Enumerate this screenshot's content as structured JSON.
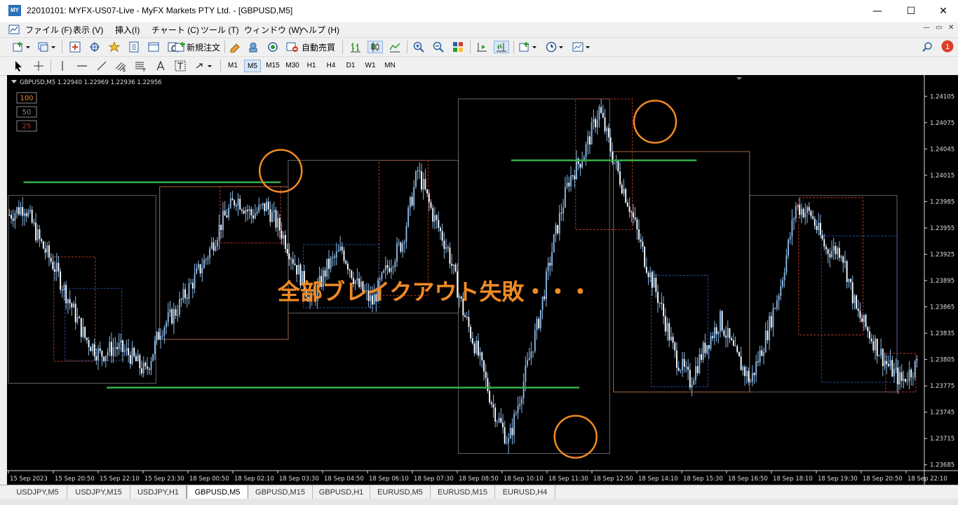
{
  "window": {
    "title": "22010101: MYFX-US07-Live - MyFX Markets PTY Ltd. - [GBPUSD,M5]",
    "app_icon": "MY",
    "controls": [
      "—",
      "☐",
      "✕"
    ]
  },
  "menu": {
    "items": [
      "ファイル (F)",
      "表示 (V)",
      "挿入(I)",
      "チャート (C)",
      "ツール (T)",
      "ウィンドウ (W)",
      "ヘルプ (H)"
    ],
    "mdi_controls": [
      "—",
      "▭",
      "✕"
    ]
  },
  "toolbar": {
    "new_order_label": "新規注文",
    "auto_trade_label": "自動売買",
    "notification_count": "1"
  },
  "timeframes": {
    "items": [
      "M1",
      "M5",
      "M15",
      "M30",
      "H1",
      "H4",
      "D1",
      "W1",
      "MN"
    ],
    "active": "M5"
  },
  "chart": {
    "header": "GBPUSD,M5  1.22940  1.22969  1.22936  1.22956",
    "badges": [
      "100",
      "50",
      "25"
    ],
    "annotation": "全部ブレイクアウト失敗・・・",
    "colors": {
      "background": "#000000",
      "candle": "#8ab8e6",
      "support_line": "#36b14a",
      "highlight_circle": "#f08a24",
      "annotation": "#f08a24"
    }
  },
  "chart_data": {
    "type": "candlestick",
    "symbol": "GBPUSD",
    "timeframe": "M5",
    "ylim": [
      1.2368,
      1.24118
    ],
    "y_ticks": [
      "1.24105",
      "1.24075",
      "1.24045",
      "1.24015",
      "1.23985",
      "1.23955",
      "1.23925",
      "1.23895",
      "1.23865",
      "1.23835",
      "1.23805",
      "1.23775",
      "1.23745",
      "1.23715",
      "1.23685"
    ],
    "x_ticks": [
      "15 Sep 2023",
      "15 Sep 20:50",
      "15 Sep 22:10",
      "15 Sep 23:30",
      "18 Sep 00:50",
      "18 Sep 02:10",
      "18 Sep 03:30",
      "18 Sep 04:50",
      "18 Sep 06:10",
      "18 Sep 07:30",
      "18 Sep 08:50",
      "18 Sep 10:10",
      "18 Sep 11:30",
      "18 Sep 12:50",
      "18 Sep 14:10",
      "18 Sep 15:30",
      "18 Sep 16:50",
      "18 Sep 18:10",
      "18 Sep 19:30",
      "18 Sep 20:50",
      "18 Sep 22:10"
    ],
    "close_path": [
      [
        0,
        1.2397
      ],
      [
        8,
        1.2398
      ],
      [
        16,
        1.2394
      ],
      [
        24,
        1.2391
      ],
      [
        32,
        1.2387
      ],
      [
        40,
        1.2383
      ],
      [
        48,
        1.2381
      ],
      [
        56,
        1.2382
      ],
      [
        64,
        1.2381
      ],
      [
        72,
        1.2379
      ],
      [
        80,
        1.2384
      ],
      [
        88,
        1.2386
      ],
      [
        96,
        1.2389
      ],
      [
        104,
        1.2392
      ],
      [
        112,
        1.2396
      ],
      [
        120,
        1.2399
      ],
      [
        128,
        1.2397
      ],
      [
        136,
        1.2398
      ],
      [
        144,
        1.2395
      ],
      [
        152,
        1.2391
      ],
      [
        160,
        1.2387
      ],
      [
        168,
        1.2391
      ],
      [
        176,
        1.2393
      ],
      [
        184,
        1.2389
      ],
      [
        192,
        1.2387
      ],
      [
        200,
        1.2391
      ],
      [
        208,
        1.2394
      ],
      [
        216,
        1.2402
      ],
      [
        224,
        1.2397
      ],
      [
        232,
        1.2393
      ],
      [
        240,
        1.2386
      ],
      [
        248,
        1.2381
      ],
      [
        256,
        1.2375
      ],
      [
        264,
        1.2371
      ],
      [
        272,
        1.2378
      ],
      [
        280,
        1.2385
      ],
      [
        288,
        1.2394
      ],
      [
        296,
        1.2401
      ],
      [
        304,
        1.2404
      ],
      [
        312,
        1.2409
      ],
      [
        320,
        1.2403
      ],
      [
        328,
        1.2398
      ],
      [
        336,
        1.2392
      ],
      [
        344,
        1.2387
      ],
      [
        352,
        1.2381
      ],
      [
        360,
        1.2378
      ],
      [
        368,
        1.2382
      ],
      [
        376,
        1.2385
      ],
      [
        384,
        1.2381
      ],
      [
        392,
        1.2378
      ],
      [
        400,
        1.2383
      ],
      [
        408,
        1.2389
      ],
      [
        416,
        1.2398
      ],
      [
        424,
        1.2397
      ],
      [
        432,
        1.2393
      ],
      [
        440,
        1.2393
      ],
      [
        448,
        1.2386
      ],
      [
        456,
        1.2383
      ],
      [
        464,
        1.238
      ],
      [
        472,
        1.2378
      ],
      [
        480,
        1.238
      ]
    ],
    "horizontal_lines": [
      {
        "from": 8,
        "to": 144,
        "y": 1.24007
      },
      {
        "from": 52,
        "to": 302,
        "y": 1.23773
      },
      {
        "from": 266,
        "to": 364,
        "y": 1.24032
      }
    ],
    "circled_points": [
      {
        "x": 144,
        "y": 1.2402
      },
      {
        "x": 300,
        "y": 1.23717
      },
      {
        "x": 342,
        "y": 1.24076
      }
    ]
  },
  "tabs": {
    "items": [
      "USDJPY,M5",
      "USDJPY,M15",
      "USDJPY,H1",
      "GBPUSD,M5",
      "GBPUSD,M15",
      "GBPUSD,H1",
      "EURUSD,M5",
      "EURUSD,M15",
      "EURUSD,H4"
    ],
    "active": "GBPUSD,M5"
  }
}
